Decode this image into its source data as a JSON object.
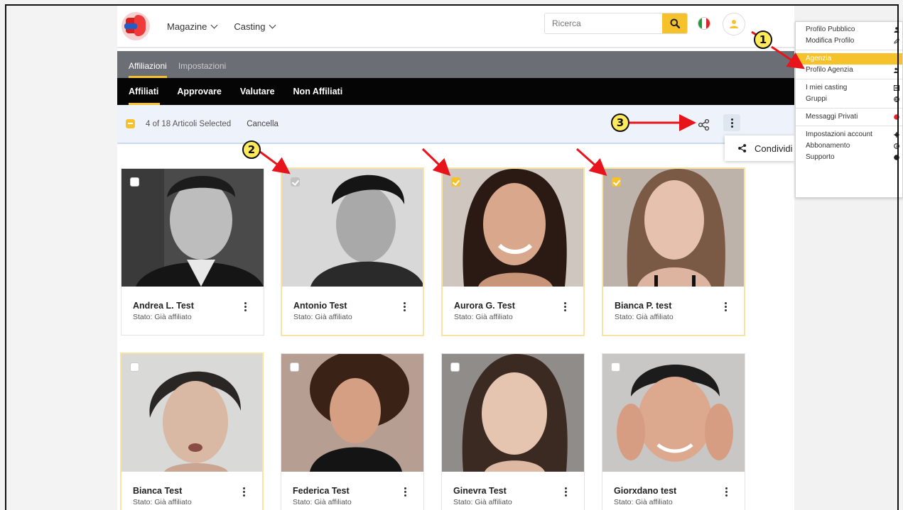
{
  "nav": {
    "items": [
      {
        "label": "Magazine"
      },
      {
        "label": "Casting"
      }
    ],
    "search_placeholder": "Ricerca"
  },
  "subnav": {
    "tabs": [
      "Affiliazioni",
      "Impostazioni"
    ]
  },
  "filters": {
    "tabs": [
      "Affiliati",
      "Approvare",
      "Valutare",
      "Non Affiliati"
    ]
  },
  "selection": {
    "count_text": "4 of 18 Articoli Selected",
    "cancel": "Cancella"
  },
  "share_menu": {
    "label": "Condividi"
  },
  "cards": [
    {
      "name": "Andrea L. Test",
      "status": "Stato: Già affiliato",
      "checked": false
    },
    {
      "name": "Antonio Test",
      "status": "Stato: Già affiliato",
      "checked": true
    },
    {
      "name": "Aurora G. Test",
      "status": "Stato: Già affiliato",
      "checked": true
    },
    {
      "name": "Bianca P. test",
      "status": "Stato: Già affiliato",
      "checked": true
    },
    {
      "name": "Bianca Test",
      "status": "Stato: Già affiliato",
      "checked": false
    },
    {
      "name": "Federica Test",
      "status": "Stato: Già affiliato",
      "checked": false
    },
    {
      "name": "Ginevra Test",
      "status": "Stato: Già affiliato",
      "checked": false
    },
    {
      "name": "Giorxdano test",
      "status": "Stato: Già affiliato",
      "checked": false
    }
  ],
  "user_menu": {
    "items": [
      {
        "label": "Profilo Pubblico",
        "icon": "user-icon"
      },
      {
        "label": "Modifica Profilo",
        "icon": "pencil-icon"
      },
      {
        "label": "Agenzia",
        "icon": "",
        "active": true
      },
      {
        "label": "Profilo Agenzia",
        "icon": "users-icon"
      },
      {
        "label": "I miei casting",
        "icon": "list-icon"
      },
      {
        "label": "Gruppi",
        "icon": "globe-icon"
      },
      {
        "label": "Messaggi Privati",
        "icon": "badge-icon"
      },
      {
        "label": "Impostazioni account",
        "icon": "gear-icon"
      },
      {
        "label": "Abbonamento",
        "icon": "info-icon"
      },
      {
        "label": "Supporto",
        "icon": "help-icon"
      }
    ]
  },
  "annotations": [
    "1",
    "2",
    "3"
  ],
  "colors": {
    "accent": "#f5c22b",
    "arrow": "#e8141b",
    "annotation_fill": "#ffea5c"
  }
}
